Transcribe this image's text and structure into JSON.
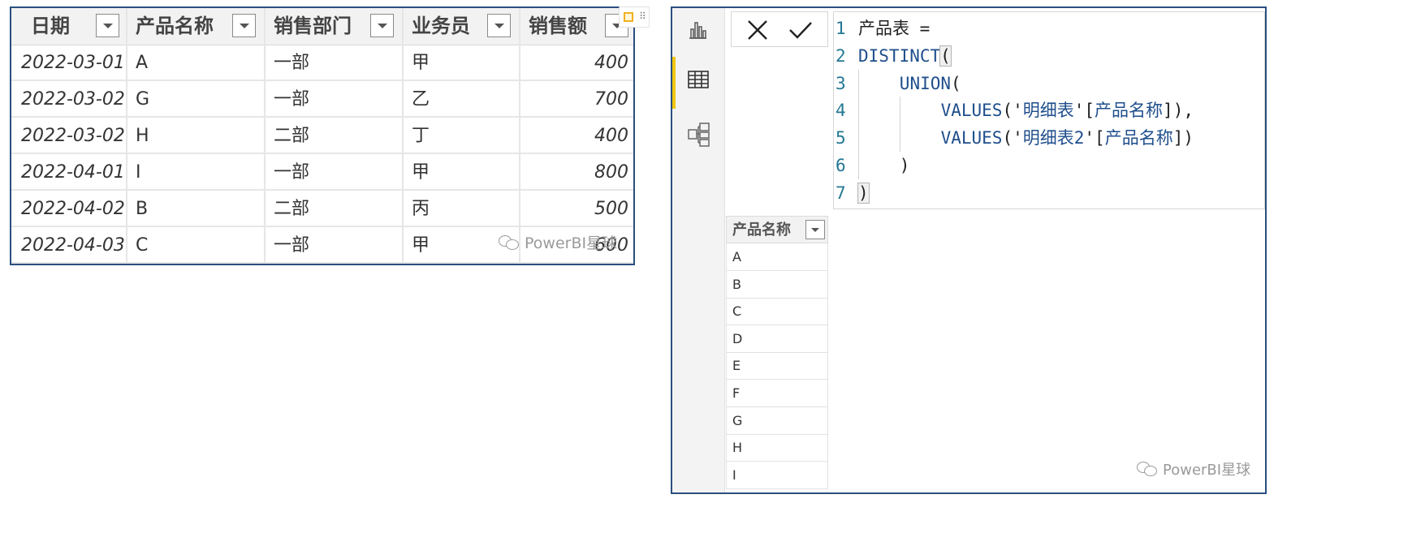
{
  "detail_table": {
    "columns": [
      "日期",
      "产品名称",
      "销售部门",
      "业务员",
      "销售额"
    ],
    "rows": [
      [
        "2022-03-01",
        "A",
        "一部",
        "甲",
        "400"
      ],
      [
        "2022-03-02",
        "G",
        "一部",
        "乙",
        "700"
      ],
      [
        "2022-03-02",
        "H",
        "二部",
        "丁",
        "400"
      ],
      [
        "2022-04-01",
        "I",
        "一部",
        "甲",
        "800"
      ],
      [
        "2022-04-02",
        "B",
        "二部",
        "丙",
        "500"
      ],
      [
        "2022-04-03",
        "C",
        "一部",
        "甲",
        "600"
      ]
    ]
  },
  "watermark": "PowerBI星球",
  "side_nav": [
    {
      "name": "report-view-icon",
      "active": false
    },
    {
      "name": "table-view-icon",
      "active": true
    },
    {
      "name": "model-view-icon",
      "active": false
    }
  ],
  "formula_bar": {
    "cancel_icon": "close-icon",
    "commit_icon": "check-icon",
    "line_numbers": [
      "1",
      "2",
      "3",
      "4",
      "5",
      "6",
      "7"
    ],
    "lines": [
      {
        "indent": "",
        "tokens": [
          [
            "产品表 =",
            "plain"
          ]
        ]
      },
      {
        "indent": "",
        "tokens": [
          [
            "DISTINCT",
            "kw"
          ],
          [
            "(",
            "bracket"
          ]
        ]
      },
      {
        "indent": "    ",
        "tokens": [
          [
            "UNION",
            "kw"
          ],
          [
            "(",
            "plain"
          ]
        ]
      },
      {
        "indent": "        ",
        "tokens": [
          [
            "VALUES",
            "kw"
          ],
          [
            "('",
            "plain"
          ],
          [
            "明细表",
            "str"
          ],
          [
            "'[",
            "plain"
          ],
          [
            "产品名称",
            "str"
          ],
          [
            "]),",
            "plain"
          ]
        ]
      },
      {
        "indent": "        ",
        "tokens": [
          [
            "VALUES",
            "kw"
          ],
          [
            "('",
            "plain"
          ],
          [
            "明细表2",
            "str"
          ],
          [
            "'[",
            "plain"
          ],
          [
            "产品名称",
            "str"
          ],
          [
            "])",
            "plain"
          ]
        ]
      },
      {
        "indent": "    ",
        "tokens": [
          [
            ")",
            "plain"
          ]
        ]
      },
      {
        "indent": "",
        "tokens": [
          [
            ")",
            "bracket"
          ]
        ]
      }
    ]
  },
  "result_table": {
    "column": "产品名称",
    "rows": [
      "A",
      "B",
      "C",
      "D",
      "E",
      "F",
      "G",
      "H",
      "I"
    ]
  },
  "colors": {
    "border": "#2a4f7f",
    "active_nav": "#f2c811",
    "keyword": "#1f4e8c",
    "line_number": "#237893"
  }
}
